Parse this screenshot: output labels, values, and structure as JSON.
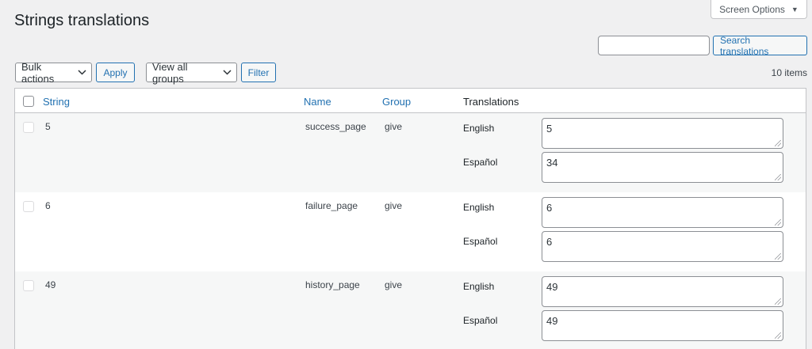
{
  "header": {
    "screen_options_label": "Screen Options",
    "title": "Strings translations"
  },
  "search": {
    "value": "",
    "placeholder": "",
    "button_label": "Search translations"
  },
  "toolbar": {
    "bulk_actions_selected": "Bulk actions",
    "apply_label": "Apply",
    "groups_selected": "View all groups",
    "filter_label": "Filter",
    "items_count": "10 items"
  },
  "table": {
    "columns": {
      "string": "String",
      "name": "Name",
      "group": "Group",
      "translations": "Translations"
    },
    "rows": [
      {
        "string": "5",
        "name": "success_page",
        "group": "give",
        "translations": [
          {
            "language": "English",
            "value": "5"
          },
          {
            "language": "Español",
            "value": "34"
          }
        ]
      },
      {
        "string": "6",
        "name": "failure_page",
        "group": "give",
        "translations": [
          {
            "language": "English",
            "value": "6"
          },
          {
            "language": "Español",
            "value": "6"
          }
        ]
      },
      {
        "string": "49",
        "name": "history_page",
        "group": "give",
        "translations": [
          {
            "language": "English",
            "value": "49"
          },
          {
            "language": "Español",
            "value": "49"
          }
        ]
      }
    ]
  },
  "icons": {
    "screen_options_caret": "caret-down-icon",
    "select_chevron": "chevron-down-icon",
    "textarea_resize": "resize-handle-icon"
  },
  "colors": {
    "accent": "#2271b1",
    "background": "#f0f0f1",
    "alt_row": "#f6f7f7"
  }
}
